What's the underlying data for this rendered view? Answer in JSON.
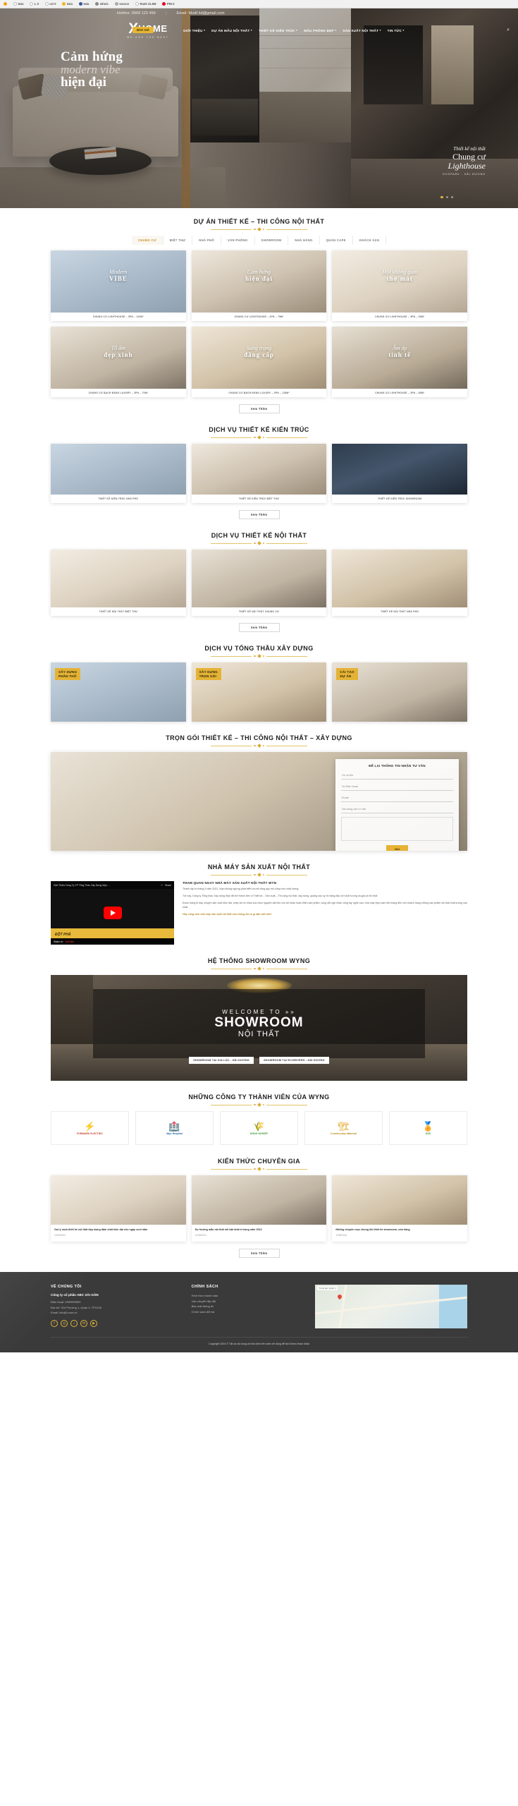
{
  "browser": {
    "bookmarks": [
      {
        "icon": "extension-icon",
        "label": ""
      },
      {
        "icon": "google-icon",
        "label": "Iwia"
      },
      {
        "icon": "circle-icon",
        "label": "L 0"
      },
      {
        "icon": "circle-icon",
        "label": "LD 0"
      },
      {
        "icon": "star-icon",
        "label": "Iwia"
      },
      {
        "icon": "facebook-icon",
        "label": "Iwia"
      },
      {
        "icon": "person-icon",
        "label": "whois"
      },
      {
        "icon": "code-icon",
        "label": "source"
      },
      {
        "icon": "rank-icon",
        "label": "Rank 31.6M"
      },
      {
        "icon": "pinterest-icon",
        "label": "PIN 0"
      }
    ]
  },
  "topbar": {
    "hotline": "Hotline: 0909 123 456",
    "separator": "|",
    "email": "Email: fdvdf.hd@gmail.com"
  },
  "header": {
    "logo_x": "X",
    "logo_home": "HOME",
    "logo_tagline": "WE ARE THE BEST",
    "nav": [
      {
        "label": "GIỚI THIỆU",
        "has_caret": true
      },
      {
        "label": "DỰ ÁN MẪU NỘI THẤT",
        "has_caret": true
      },
      {
        "label": "THIẾT KẾ KIẾN TRÚC",
        "has_caret": true
      },
      {
        "label": "MẪU PHÒNG ĐẸP",
        "has_caret": true
      },
      {
        "label": "SẢN XUẤT NỘI THẤT",
        "has_caret": true
      },
      {
        "label": "TIN TỨC",
        "has_caret": true
      }
    ],
    "search_icon": "search-icon",
    "cta": "BÁO GIÁ"
  },
  "hero": {
    "line1": "Cảm hứng",
    "line2": "modern vibe",
    "line3": "hiện đại",
    "right_line1": "Thiết kế nội thất",
    "right_line2": "Chung cư",
    "right_line3": "Lighthouse",
    "right_line4": "ECOPARK - HẢI DƯƠNG",
    "dots": 3,
    "active_dot": 0
  },
  "projects": {
    "title": "DỰ ÁN THIẾT KẾ – THI CÔNG NỘI THẤT",
    "tabs": [
      "CHUNG CƯ",
      "BIỆT THỰ",
      "NHÀ PHỐ",
      "VĂN PHÒNG",
      "SHOWROOM",
      "NHÀ HÀNG",
      "QUÁN CAFE",
      "KHÁCH SẠN"
    ],
    "active_tab": "CHUNG CƯ",
    "items": [
      {
        "overlay_top": "Modern",
        "overlay_bottom": "VIBE",
        "caption": "CHUNG CƯ LIGHTHOUSE – 3PN – 110M²"
      },
      {
        "overlay_top": "Cảm hứng",
        "overlay_bottom": "hiện đại",
        "caption": "CHUNG CƯ LIGHTHOUSE – 2PN – 75M²"
      },
      {
        "overlay_top": "Một không gian",
        "overlay_bottom": "thơ mát",
        "caption": "CHUNG CƯ LIGHTHOUSE – 3PN – 95M²"
      },
      {
        "overlay_top": "Tổ ấm",
        "overlay_bottom": "đẹp xinh",
        "caption": "CHUNG CƯ BẠCH ĐẰNG LUXURY – 2PN – 70M²"
      },
      {
        "overlay_top": "Sang trọng",
        "overlay_bottom": "đẳng cấp",
        "caption": "CHUNG CƯ BẠCH ĐẰNG LUXURY – 3PN – 118M²"
      },
      {
        "overlay_top": "Ấm áp",
        "overlay_bottom": "tinh tế",
        "caption": "CHUNG CƯ LIGHTHOUSE – 2PN – 68M²"
      }
    ],
    "more_label": "Xem Thêm"
  },
  "architecture": {
    "title": "DỊCH VỤ THIẾT KẾ KIẾN TRÚC",
    "items": [
      {
        "caption": "THIẾT KẾ KIẾN TRÚC NHÀ PHỐ"
      },
      {
        "caption": "THIẾT KẾ KIẾN TRÚC BIỆT THỰ"
      },
      {
        "caption": "THIẾT KẾ KIẾN TRÚC SHOWROOM"
      }
    ],
    "more_label": "Xem Thêm"
  },
  "interior": {
    "title": "DỊCH VỤ THIẾT KẾ NỘI THẤT",
    "items": [
      {
        "caption": "THIẾT KẾ NỘI THẤT BIỆT THỰ"
      },
      {
        "caption": "THIẾT KẾ NỘI THẤT CHUNG CƯ"
      },
      {
        "caption": "THIẾT KẾ NỘI THẤT NHÀ PHỐ"
      }
    ],
    "more_label": "Xem Thêm"
  },
  "construction": {
    "title": "DỊCH VỤ TỔNG THẦU XÂY DỰNG",
    "items": [
      {
        "label": "XÂY DỰNG\nPHẦN THÔ"
      },
      {
        "label": "XÂY DỰNG\nTRỌN GÓI"
      },
      {
        "label": "CẢI TẠO\nDỰ ÁN"
      }
    ]
  },
  "combo": {
    "title": "TRỌN GÓI THIẾT KẾ – THI CÔNG NỘI THẤT – XÂY DỰNG",
    "form": {
      "heading": "ĐỂ LẠI THÔNG TIN NHẬN TƯ VẤN",
      "fields": [
        {
          "placeholder": "Họ và tên"
        },
        {
          "placeholder": "Số Điện thoại"
        },
        {
          "placeholder": "Email"
        },
        {
          "placeholder": "Nội dung cần tư vấn"
        }
      ],
      "submit": "Gửi"
    }
  },
  "factory": {
    "title": "NHÀ MÁY SẢN XUẤT NỘI THẤT",
    "video": {
      "title": "Giới Thiệu Công Ty CP Tổng Thầu Xây Dựng Wyn ...",
      "share": "Share",
      "watch_later": "Watch later",
      "watch_on": "Watch on",
      "platform": "YouTube",
      "band_text": "ĐỘT PHÁ"
    },
    "article": {
      "heading": "THAM QUAN NGAY NHÀ MÁY SẢN XUẤT NỘI THẤT WYN",
      "p1": "Thành lập từ tháng 3 năm 2021, Wyn không ngừng phát triển và mở rộng quy mô cũng như chất lượng.",
      "p2": "Tới nay, Công ty Tổng thầu Xây dựng Wyn đã trở thành đơn vị Thiết kế – Sản xuất – Thi công nội thất, xây dựng, quảng cáo uy tín hàng đầu với chất lượng và giá cả tốt nhất.",
      "p3": "Được trang bị dây chuyền sản xuất hiện đại, khép kín từ khâu lựa chọn nguyên vật liệu cho tới khâu hoàn thiện sản phẩm, cùng đội ngũ nhân công tay nghề cao, nhà máy Wyn cam kết mang đến cho khách hàng những sản phẩm nội thất chất lượng cao nhất.",
      "p4": "Hãy cùng xem nhà máy sản xuất nội thất của chúng tôi có gì đặc biệt nhé!"
    }
  },
  "showroom": {
    "title": "HỆ THỐNG SHOWROOM WYNG",
    "welcome": "WELCOME TO",
    "arrow": "»»",
    "big": "SHOWROOM",
    "sub": "NỘI THẤT",
    "buttons": [
      "SHOWROOM TẠI GIA LỘC - HẢI DƯƠNG",
      "SHOWROOM TẠI ECORIVERS - HẢI DƯƠNG"
    ]
  },
  "partners": {
    "title": "NHỮNG CÔNG TY THÀNH VIÊN CỦA WYNG",
    "items": [
      {
        "mark": "⚡",
        "name": "FORWARD ELECTRIC"
      },
      {
        "mark": "🏥",
        "name": "Wyn Hospital"
      },
      {
        "mark": "🌾",
        "name": "NÔNG NGHIỆP"
      },
      {
        "mark": "🏗",
        "name": "Construction Material"
      },
      {
        "mark": "🏅",
        "name": "KZS"
      }
    ]
  },
  "blog": {
    "title": "KIẾN THỨC CHUYÊN GIA",
    "items": [
      {
        "title": "Gợi ý cách thiết kế nội thất đẹp mang đậm chất hiện đại cho ngày cuối năm",
        "date": "12/08/2024"
      },
      {
        "title": "Sự hướng mẫu nội thất nổi bật nhất ở trong năm 2022",
        "date": "12/08/2024"
      },
      {
        "title": "Những chuyên mục chung khi thiết kế showroom, cửa hàng",
        "date": "12/08/2024"
      }
    ],
    "more_label": "Xem Thêm"
  },
  "footer": {
    "about_heading": "VỀ CHÚNG TÔI",
    "company": "Công ty cổ phần ABC SÀI GÒN",
    "phone": "Điện thoại: 0999999999",
    "address": "Địa chỉ: 324 Phường 1, Quận 4, TPHCM",
    "email": "Email: info@i.com.vn",
    "socials": [
      "facebook-icon",
      "instagram-icon",
      "tiktok-icon",
      "mail-icon",
      "youtube-icon"
    ],
    "policy_heading": "CHÍNH SÁCH",
    "policy_links": [
      "Hình thức thanh toán",
      "Vận chuyển lắp đặt",
      "Bảo mật thông tin",
      "Chính sách đổi trả"
    ],
    "map_label": "Trung tâm Quận 4",
    "copyright_prefix": "Copyright 2024 © Tất cả nội dung và hình ảnh trên web chỉ dùng để làm Demo tham khảo"
  }
}
